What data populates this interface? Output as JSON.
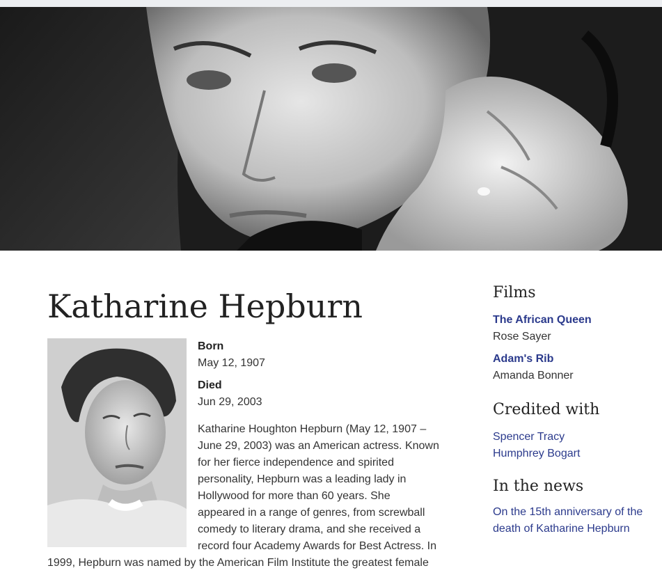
{
  "person": {
    "name": "Katharine Hepburn",
    "born_label": "Born",
    "born_value": "May 12, 1907",
    "died_label": "Died",
    "died_value": "Jun 29, 2003",
    "bio_lines": [
      "Katharine Houghton Hepburn (May 12, 1907 –",
      "June 29, 2003) was an American actress. Known",
      "for her fierce independence and spirited",
      "personality, Hepburn was a leading lady in",
      "Hollywood for more than 60 years. She",
      "appeared in a range of genres, from screwball",
      "comedy to literary drama, and she received a",
      "record four Academy Awards for Best Actress. In",
      "1999, Hepburn was named by the American Film Institute the greatest female"
    ]
  },
  "sidebar": {
    "films_heading": "Films",
    "films": [
      {
        "title": "The African Queen",
        "role": "Rose Sayer"
      },
      {
        "title": "Adam's Rib",
        "role": "Amanda Bonner"
      }
    ],
    "credited_heading": "Credited with",
    "credited": [
      "Spencer Tracy",
      "Humphrey Bogart"
    ],
    "news_heading": "In the news",
    "news_lines": [
      "On the 15th anniversary of the",
      "death of Katharine Hepburn"
    ]
  },
  "colors": {
    "link": "#2b3a8c",
    "text": "#333333",
    "topbar": "#eceef1"
  }
}
